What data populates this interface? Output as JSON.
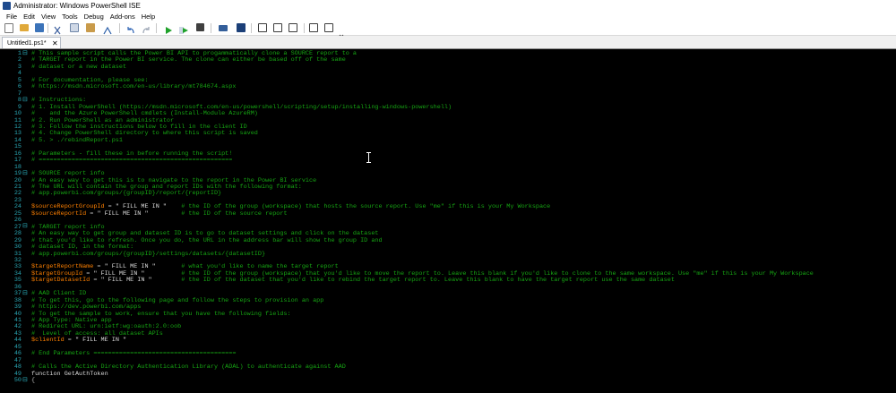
{
  "window": {
    "title": "Administrator: Windows PowerShell ISE"
  },
  "menubar": {
    "items": [
      "File",
      "Edit",
      "View",
      "Tools",
      "Debug",
      "Add-ons",
      "Help"
    ]
  },
  "toolbar": {
    "buttons": [
      "new-script",
      "open",
      "save",
      "cut",
      "copy",
      "paste",
      "clear-console",
      "undo",
      "redo",
      "run-script",
      "run-selection",
      "stop",
      "new-remote-tab",
      "start-powershell",
      "show-script-pane-top",
      "show-script-pane-right",
      "show-script-pane-maximized",
      "show-command-window",
      "show-command-add-on"
    ]
  },
  "tabs": [
    {
      "label": "Untitled1.ps1*",
      "close": "✕"
    }
  ],
  "editor": {
    "lines": [
      {
        "n": "1",
        "segs": [
          {
            "t": "# This sample script calls the Power BI API to progammatically clone a SOURCE report to a",
            "c": "cmt"
          }
        ]
      },
      {
        "n": "2",
        "segs": [
          {
            "t": "# TARGET report in the Power BI service. The clone can either be based off of the same",
            "c": "cmt"
          }
        ]
      },
      {
        "n": "3",
        "segs": [
          {
            "t": "# dataset or a new dataset",
            "c": "cmt"
          }
        ]
      },
      {
        "n": "4",
        "segs": []
      },
      {
        "n": "5",
        "segs": [
          {
            "t": "# For documentation, please see:",
            "c": "cmt"
          }
        ]
      },
      {
        "n": "6",
        "segs": [
          {
            "t": "# https://msdn.microsoft.com/en-us/library/mt784674.aspx",
            "c": "cmt"
          }
        ]
      },
      {
        "n": "7",
        "segs": []
      },
      {
        "n": "8",
        "segs": [
          {
            "t": "# Instructions:",
            "c": "cmt"
          }
        ]
      },
      {
        "n": "9",
        "segs": [
          {
            "t": "# 1. Install PowerShell (https://msdn.microsoft.com/en-us/powershell/scripting/setup/installing-windows-powershell)",
            "c": "cmt"
          }
        ]
      },
      {
        "n": "10",
        "segs": [
          {
            "t": "#    and the Azure PowerShell cmdlets (Install-Module AzureRM)",
            "c": "cmt"
          }
        ]
      },
      {
        "n": "11",
        "segs": [
          {
            "t": "# 2. Run PowerShell as an administrator",
            "c": "cmt"
          }
        ]
      },
      {
        "n": "12",
        "segs": [
          {
            "t": "# 3. Follow the instructions below to fill in the client ID",
            "c": "cmt"
          }
        ]
      },
      {
        "n": "13",
        "segs": [
          {
            "t": "# 4. Change PowerShell directory to where this script is saved",
            "c": "cmt"
          }
        ]
      },
      {
        "n": "14",
        "segs": [
          {
            "t": "# 5. > ./rebindReport.ps1",
            "c": "cmt"
          }
        ]
      },
      {
        "n": "15",
        "segs": []
      },
      {
        "n": "16",
        "segs": [
          {
            "t": "# Parameters - fill these in before running the script!",
            "c": "cmt"
          }
        ]
      },
      {
        "n": "17",
        "segs": [
          {
            "t": "# =====================================================",
            "c": "cmt"
          }
        ]
      },
      {
        "n": "18",
        "segs": []
      },
      {
        "n": "19",
        "segs": [
          {
            "t": "# SOURCE report info",
            "c": "cmt"
          }
        ]
      },
      {
        "n": "20",
        "segs": [
          {
            "t": "# An easy way to get this is to navigate to the report in the Power BI service",
            "c": "cmt"
          }
        ]
      },
      {
        "n": "21",
        "segs": [
          {
            "t": "# The URL will contain the group and report IDs with the following format:",
            "c": "cmt"
          }
        ]
      },
      {
        "n": "22",
        "segs": [
          {
            "t": "# app.powerbi.com/groups/{groupID}/report/{reportID}",
            "c": "cmt"
          }
        ]
      },
      {
        "n": "23",
        "segs": []
      },
      {
        "n": "24",
        "segs": [
          {
            "t": "$sourceReportGroupId",
            "c": "var"
          },
          {
            "t": " = ",
            "c": "op"
          },
          {
            "t": "\" FILL ME IN \"",
            "c": "str"
          },
          {
            "t": "    # the ID of the group (workspace) that hosts the source report. Use \"me\" if this is your My Workspace",
            "c": "cmt"
          }
        ]
      },
      {
        "n": "25",
        "segs": [
          {
            "t": "$sourceReportId",
            "c": "var"
          },
          {
            "t": " = ",
            "c": "op"
          },
          {
            "t": "\" FILL ME IN \"",
            "c": "str"
          },
          {
            "t": "         # the ID of the source report",
            "c": "cmt"
          }
        ]
      },
      {
        "n": "26",
        "segs": []
      },
      {
        "n": "27",
        "segs": [
          {
            "t": "# TARGET report info",
            "c": "cmt"
          }
        ]
      },
      {
        "n": "28",
        "segs": [
          {
            "t": "# An easy way to get group and dataset ID is to go to dataset settings and click on the dataset",
            "c": "cmt"
          }
        ]
      },
      {
        "n": "29",
        "segs": [
          {
            "t": "# that you'd like to refresh. Once you do, the URL in the address bar will show the group ID and",
            "c": "cmt"
          }
        ]
      },
      {
        "n": "30",
        "segs": [
          {
            "t": "# dataset ID, in the format:",
            "c": "cmt"
          }
        ]
      },
      {
        "n": "31",
        "segs": [
          {
            "t": "# app.powerbi.com/groups/{groupID}/settings/datasets/{datasetID}",
            "c": "cmt"
          }
        ]
      },
      {
        "n": "32",
        "segs": []
      },
      {
        "n": "33",
        "segs": [
          {
            "t": "$targetReportName",
            "c": "var"
          },
          {
            "t": " = ",
            "c": "op"
          },
          {
            "t": "\" FILL ME IN \"",
            "c": "str"
          },
          {
            "t": "       # what you'd like to name the target report",
            "c": "cmt"
          }
        ]
      },
      {
        "n": "34",
        "segs": [
          {
            "t": "$targetGroupId",
            "c": "var"
          },
          {
            "t": " = ",
            "c": "op"
          },
          {
            "t": "\" FILL ME IN \"",
            "c": "str"
          },
          {
            "t": "          # the ID of the group (workspace) that you'd like to move the report to. Leave this blank if you'd like to clone to the same workspace. Use \"me\" if this is your My Workspace",
            "c": "cmt"
          }
        ]
      },
      {
        "n": "35",
        "segs": [
          {
            "t": "$targetDatasetId",
            "c": "var"
          },
          {
            "t": " = ",
            "c": "op"
          },
          {
            "t": "\" FILL ME IN \"",
            "c": "str"
          },
          {
            "t": "        # the ID of the dataset that you'd like to rebind the target report to. Leave this blank to have the target report use the same dataset",
            "c": "cmt"
          }
        ]
      },
      {
        "n": "36",
        "segs": []
      },
      {
        "n": "37",
        "segs": [
          {
            "t": "# AAD Client ID",
            "c": "cmt"
          }
        ]
      },
      {
        "n": "38",
        "segs": [
          {
            "t": "# To get this, go to the following page and follow the steps to provision an app",
            "c": "cmt"
          }
        ]
      },
      {
        "n": "39",
        "segs": [
          {
            "t": "# https://dev.powerbi.com/apps",
            "c": "cmt"
          }
        ]
      },
      {
        "n": "40",
        "segs": [
          {
            "t": "# To get the sample to work, ensure that you have the following fields:",
            "c": "cmt"
          }
        ]
      },
      {
        "n": "41",
        "segs": [
          {
            "t": "# App Type: Native app",
            "c": "cmt"
          }
        ]
      },
      {
        "n": "42",
        "segs": [
          {
            "t": "# Redirect URL: urn:ietf:wg:oauth:2.0:oob",
            "c": "cmt"
          }
        ]
      },
      {
        "n": "43",
        "segs": [
          {
            "t": "#  Level of access: all dataset APIs",
            "c": "cmt"
          }
        ]
      },
      {
        "n": "44",
        "segs": [
          {
            "t": "$clientId",
            "c": "var"
          },
          {
            "t": " = ",
            "c": "op"
          },
          {
            "t": "\" FILL ME IN \"",
            "c": "str"
          }
        ]
      },
      {
        "n": "45",
        "segs": []
      },
      {
        "n": "46",
        "segs": [
          {
            "t": "# End Parameters =======================================",
            "c": "cmt"
          }
        ]
      },
      {
        "n": "47",
        "segs": []
      },
      {
        "n": "48",
        "segs": [
          {
            "t": "# Calls the Active Directory Authentication Library (ADAL) to authenticate against AAD",
            "c": "cmt"
          }
        ]
      },
      {
        "n": "49",
        "segs": [
          {
            "t": "function",
            "c": "kw"
          },
          {
            "t": " GetAuthToken",
            "c": "kw"
          }
        ]
      },
      {
        "n": "50",
        "segs": [
          {
            "t": "{",
            "c": "op"
          }
        ]
      }
    ]
  },
  "colors": {
    "comment": "#16a513",
    "variable": "#ff8000",
    "line_number": "#2aa7b5",
    "editor_bg": "#000000"
  }
}
